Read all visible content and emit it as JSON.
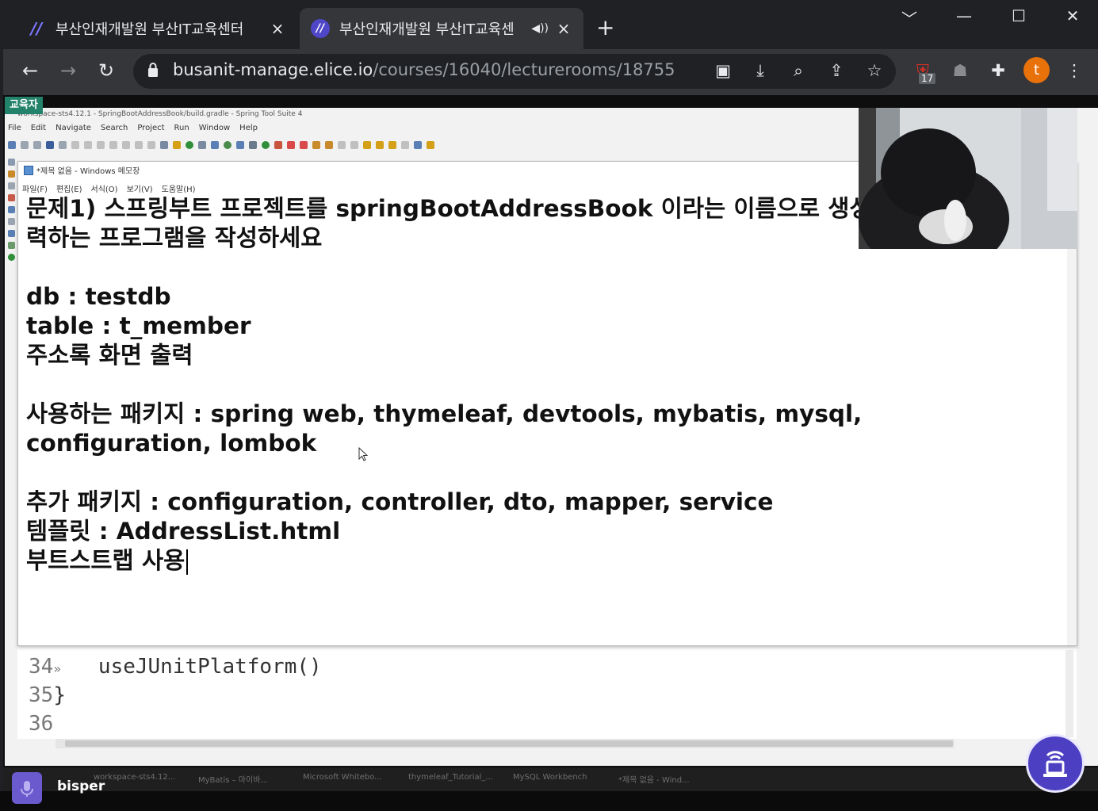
{
  "browser": {
    "tabs": [
      {
        "title": "부산인재개발원 부산IT교육센터",
        "close": "×"
      },
      {
        "title": "부산인재개발원 부산IT교육센",
        "close": "×"
      }
    ],
    "new_tab": "+",
    "url_domain": "busanit-manage.elice.io",
    "url_path": "/courses/16040/lecturerooms/18755",
    "profile_initial": "t",
    "extension_badge": "17"
  },
  "page": {
    "role_badge": "교육자"
  },
  "sts": {
    "window_title": "workspace-sts4.12.1 - SpringBootAddressBook/build.gradle - Spring Tool Suite 4",
    "menu": [
      "File",
      "Edit",
      "Navigate",
      "Search",
      "Project",
      "Run",
      "Window",
      "Help"
    ],
    "code_lines": [
      {
        "num": "34",
        "marker": "»",
        "code": "   useJUnitPlatform()"
      },
      {
        "num": "35",
        "marker": "",
        "code": "}"
      },
      {
        "num": "36",
        "marker": "",
        "code": ""
      }
    ]
  },
  "notepad": {
    "title": "*제목 없음 - Windows 메모장",
    "menu": [
      "파일(F)",
      "편집(E)",
      "서식(O)",
      "보기(V)",
      "도움말(H)"
    ],
    "lines": [
      "문제1) 스프링부트 프로젝트를 springBootAddressBook 이라는 이름으로 생성",
      "력하는 프로그램을 작성하세요",
      "",
      "db : testdb",
      "table : t_member",
      "주소록 화면 출력",
      "",
      "사용하는 패키지 : spring web, thymeleaf, devtools, mybatis, mysql,",
      "configuration, lombok",
      "",
      "추가 패키지 : configuration, controller, dto, mapper, service",
      "템플릿 : AddressList.html",
      "부트스트랩 사용"
    ]
  },
  "taskbar": {
    "items": [
      "workspace-sts4.12...",
      "MyBatis – 마이바...",
      "Microsoft Whitebo...",
      "thymeleaf_Tutorial_...",
      "MySQL Workbench",
      "*제목 없음 - Wind..."
    ]
  },
  "participant": {
    "name": "bisper"
  },
  "colors": {
    "tab_bg": "#202124",
    "toolbar_bg": "#35363a",
    "badge_green": "#23826a",
    "accent": "#4c3fc2",
    "profile": "#e8710a"
  }
}
